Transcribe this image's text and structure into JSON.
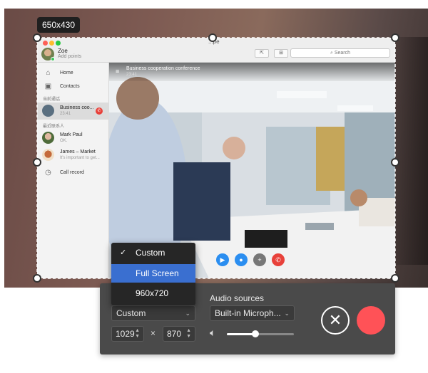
{
  "capture": {
    "size_badge": "650x430"
  },
  "app": {
    "window_title": "...pe",
    "user": {
      "name": "Zoe",
      "status": "Add points"
    },
    "search_placeholder": "Search",
    "nav": [
      {
        "label": "Home",
        "icon": "home-icon"
      },
      {
        "label": "Contacts",
        "icon": "contacts-icon"
      }
    ],
    "section_current": "当前通话",
    "section_recent": "最近联系人",
    "current_call": {
      "name": "Business coo...",
      "time": "23:41"
    },
    "recent": [
      {
        "name": "Mark Paul",
        "sub": "OK."
      },
      {
        "name": "James – Market",
        "sub": "It's important to get..."
      }
    ],
    "call_record_label": "Call record"
  },
  "video": {
    "title": "Business cooperation conference",
    "time": "23:41"
  },
  "recorder": {
    "dropdown_options": [
      "Custom",
      "Full Screen",
      "960x720"
    ],
    "dropdown_checked": "Custom",
    "dropdown_highlighted": "Full Screen",
    "region_select": "Custom",
    "width": "1029",
    "height": "870",
    "times_symbol": "×",
    "audio_label": "Audio sources",
    "audio_select": "Built-in Microph...",
    "volume_level": 0.43,
    "colors": {
      "record": "#ff5257",
      "highlight": "#3a6fd0"
    }
  }
}
